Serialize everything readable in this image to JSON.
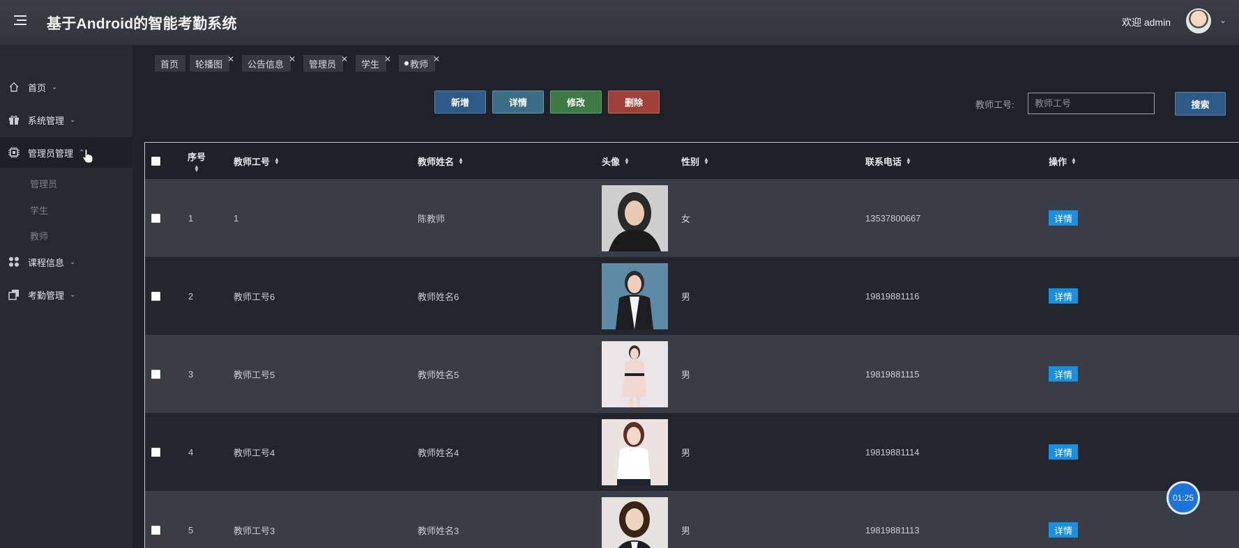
{
  "header": {
    "title": "基于Android的智能考勤系统",
    "welcome": "欢迎 admin"
  },
  "sidebar": {
    "items": [
      {
        "label": "首页"
      },
      {
        "label": "系统管理"
      },
      {
        "label": "管理员管理"
      },
      {
        "label": "课程信息"
      },
      {
        "label": "考勤管理"
      }
    ],
    "subitems": [
      "管理员",
      "学生",
      "教师"
    ]
  },
  "tabs": [
    {
      "label": "首页"
    },
    {
      "label": "轮播图"
    },
    {
      "label": "公告信息"
    },
    {
      "label": "管理员"
    },
    {
      "label": "学生"
    },
    {
      "label": "教师"
    }
  ],
  "toolbar": {
    "add_label": "新增",
    "detail_label": "详情",
    "edit_label": "修改",
    "delete_label": "删除",
    "search_label": "教师工号:",
    "search_placeholder": "教师工号",
    "search_button": "搜索"
  },
  "table": {
    "columns": [
      "序号",
      "教师工号",
      "教师姓名",
      "头像",
      "性别",
      "联系电话",
      "操作"
    ],
    "rows": [
      {
        "index": "1",
        "teacher_id": "1",
        "name": "陈教师",
        "gender": "女",
        "phone": "13537800667",
        "action": "详情"
      },
      {
        "index": "2",
        "teacher_id": "教师工号6",
        "name": "教师姓名6",
        "gender": "男",
        "phone": "19819881116",
        "action": "详情"
      },
      {
        "index": "3",
        "teacher_id": "教师工号5",
        "name": "教师姓名5",
        "gender": "男",
        "phone": "19819881115",
        "action": "详情"
      },
      {
        "index": "4",
        "teacher_id": "教师工号4",
        "name": "教师姓名4",
        "gender": "男",
        "phone": "19819881114",
        "action": "详情"
      },
      {
        "index": "5",
        "teacher_id": "教师工号3",
        "name": "教师姓名3",
        "gender": "男",
        "phone": "19819881113",
        "action": "详情"
      }
    ]
  },
  "timer": "01:25",
  "colors": {
    "primary_button": "#2d5a86",
    "detail_button": "#3b6e86",
    "edit_button": "#3e7a46",
    "delete_button": "#9f4138",
    "row_action": "#1a8fe0"
  }
}
